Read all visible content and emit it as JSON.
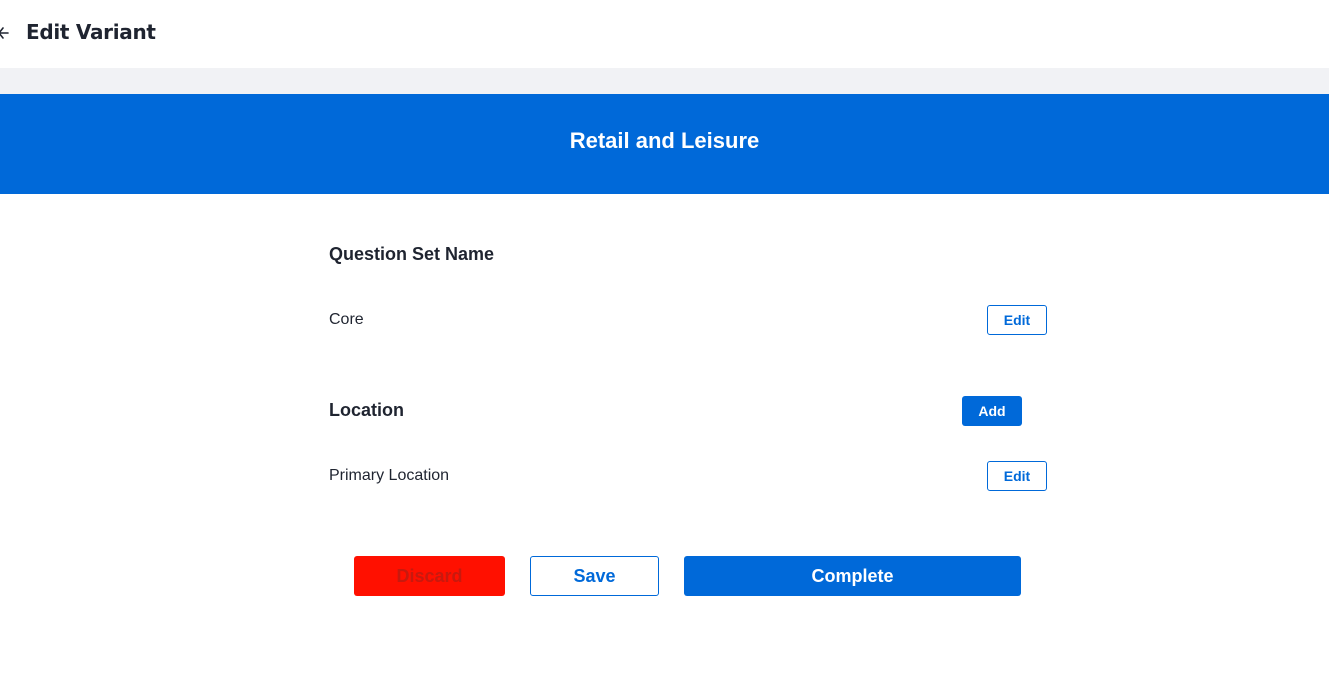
{
  "header": {
    "title": "Edit Variant",
    "back_icon": "arrow-left-icon"
  },
  "banner": {
    "title": "Retail and Leisure",
    "color": "#0069d9"
  },
  "question_set": {
    "heading": "Question Set Name",
    "item_label": "Core",
    "edit_label": "Edit"
  },
  "location": {
    "heading": "Location",
    "add_label": "Add",
    "item_label": "Primary Location",
    "edit_label": "Edit"
  },
  "actions": {
    "discard_label": "Discard",
    "save_label": "Save",
    "complete_label": "Complete"
  },
  "colors": {
    "primary": "#0069d9",
    "danger": "#ff1000",
    "strip": "#f1f2f5"
  }
}
